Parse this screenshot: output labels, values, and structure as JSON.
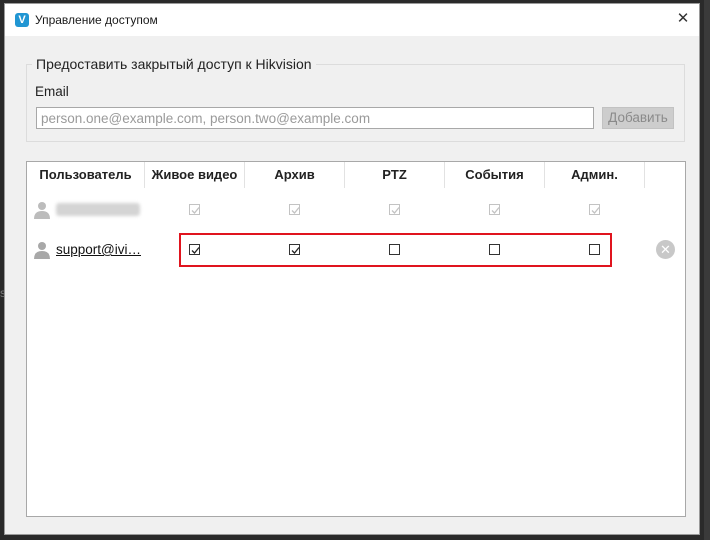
{
  "background": {
    "edge_char": "s"
  },
  "window": {
    "title": "Управление доступом",
    "app_icon_letter": "V",
    "close_glyph": "✕"
  },
  "share": {
    "group_title": "Предоставить закрытый доступ к Hikvision",
    "email_label": "Email",
    "email_placeholder": "person.one@example.com, person.two@example.com",
    "email_value": "",
    "add_button": "Добавить"
  },
  "table": {
    "headers": [
      "Пользователь",
      "Живое видео",
      "Архив",
      "PTZ",
      "События",
      "Админ."
    ],
    "rows": [
      {
        "user": "",
        "user_obscured": true,
        "permissions": [
          true,
          true,
          true,
          true,
          true
        ],
        "disabled": true,
        "removable": false
      },
      {
        "user": "support@ivi…",
        "user_obscured": false,
        "permissions": [
          true,
          true,
          false,
          false,
          false
        ],
        "disabled": false,
        "removable": true,
        "highlighted": true
      }
    ],
    "remove_glyph": "✕"
  },
  "colors": {
    "highlight": "#e0141e",
    "accent": "#2196d3"
  },
  "icons": {
    "user_avatar": "user-icon",
    "remove": "close-circle-icon",
    "check": "checkmark-icon"
  }
}
